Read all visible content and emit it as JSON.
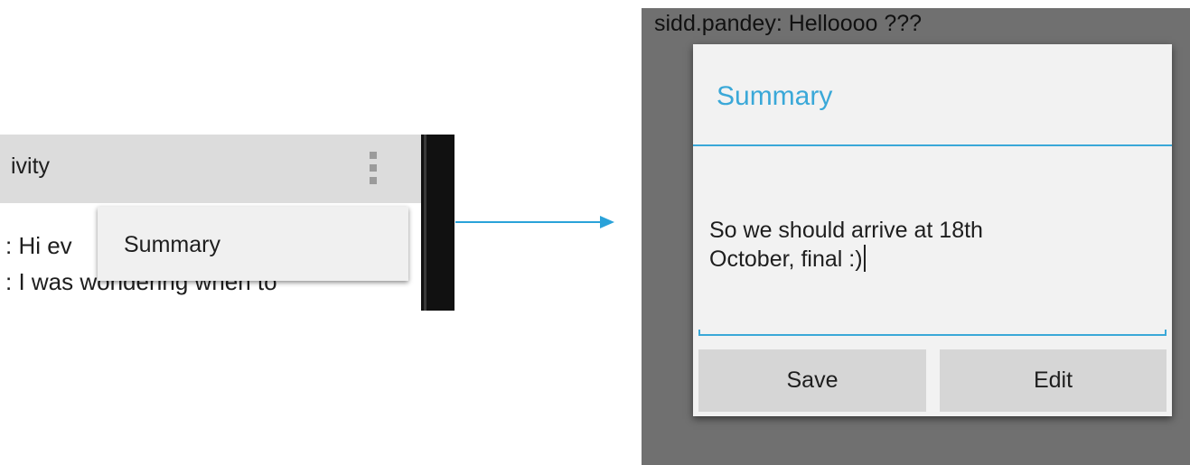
{
  "left_crop": {
    "actionbar_title": "ivity",
    "chat_lines": [
      ": Hi ev",
      ": I was wondering when to"
    ],
    "menu_items": [
      "Summary"
    ]
  },
  "right_screen": {
    "background_chat": "sidd.pandey: Helloooo ???",
    "dialog": {
      "title": "Summary",
      "text_line1": "So we should arrive at 18th",
      "text_line2": "October, final :)",
      "save_label": "Save",
      "edit_label": "Edit"
    }
  },
  "colors": {
    "accent": "#3aa8d8",
    "arrow": "#2aa2d9"
  }
}
